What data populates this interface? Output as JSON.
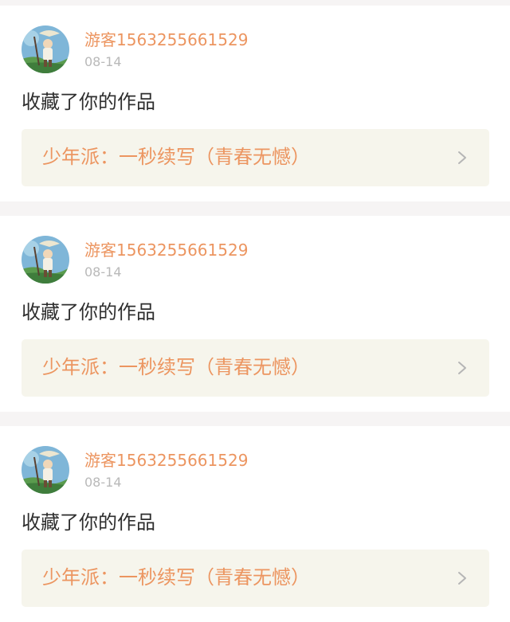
{
  "feed": {
    "items": [
      {
        "username": "游客1563255661529",
        "date": "08-14",
        "action": "收藏了你的作品",
        "work_title": "少年派：一秒续写（青春无憾）",
        "avatar_icon": "user-avatar-illustration",
        "chevron_icon": "chevron-right-icon"
      },
      {
        "username": "游客1563255661529",
        "date": "08-14",
        "action": "收藏了你的作品",
        "work_title": "少年派：一秒续写（青春无憾）",
        "avatar_icon": "user-avatar-illustration",
        "chevron_icon": "chevron-right-icon"
      },
      {
        "username": "游客1563255661529",
        "date": "08-14",
        "action": "收藏了你的作品",
        "work_title": "少年派：一秒续写（青春无憾）",
        "avatar_icon": "user-avatar-illustration",
        "chevron_icon": "chevron-right-icon"
      }
    ]
  },
  "colors": {
    "accent": "#ec9560",
    "page_background": "#f6f4f4",
    "card_background": "#ffffff",
    "work_link_background": "#f6f5ec",
    "date_text": "#b9b9b9",
    "body_text": "#2e2e2e"
  }
}
